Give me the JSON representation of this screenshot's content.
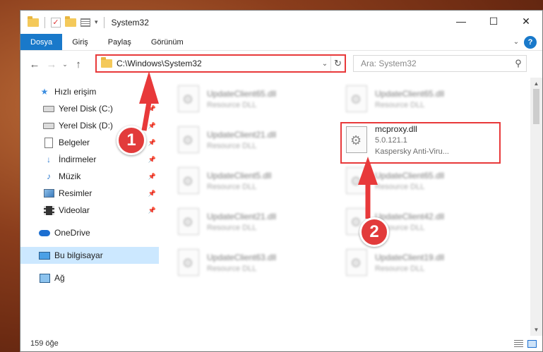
{
  "window": {
    "title": "System32",
    "controls": {
      "minimize": "—",
      "maximize": "☐",
      "close": "✕"
    }
  },
  "ribbon": {
    "tabs": [
      {
        "label": "Dosya",
        "active": true
      },
      {
        "label": "Giriş"
      },
      {
        "label": "Paylaş"
      },
      {
        "label": "Görünüm"
      }
    ],
    "help": "?"
  },
  "navbar": {
    "address": "C:\\Windows\\System32",
    "search_placeholder": "Ara: System32"
  },
  "sidebar": {
    "items": [
      {
        "label": "Hızlı erişim",
        "icon": "star-icon"
      },
      {
        "label": "Yerel Disk (C:)",
        "icon": "drive-icon",
        "pinned": true
      },
      {
        "label": "Yerel Disk (D:)",
        "icon": "drive-icon",
        "pinned": true
      },
      {
        "label": "Belgeler",
        "icon": "documents-icon",
        "pinned": true
      },
      {
        "label": "İndirmeler",
        "icon": "download-icon",
        "pinned": true
      },
      {
        "label": "Müzik",
        "icon": "music-icon",
        "pinned": true
      },
      {
        "label": "Resimler",
        "icon": "pictures-icon",
        "pinned": true
      },
      {
        "label": "Videolar",
        "icon": "videos-icon",
        "pinned": true
      },
      {
        "label": "OneDrive",
        "icon": "onedrive-icon"
      },
      {
        "label": "Bu bilgisayar",
        "icon": "this-pc-icon",
        "selected": true
      },
      {
        "label": "Ağ",
        "icon": "network-icon"
      }
    ]
  },
  "files": [
    {
      "name": "UpdateClient65.dll",
      "type": "Resource DLL"
    },
    {
      "name": "UpdateClient65.dll",
      "type": "Resource DLL"
    },
    {
      "name": "UpdateClient21.dll",
      "type": "Resource DLL"
    },
    {
      "name": "mcproxy.dll",
      "version": "5.0.121.1",
      "company": "Kaspersky Anti-Viru..."
    },
    {
      "name": "UpdateClient5.dll",
      "type": "Resource DLL"
    },
    {
      "name": "UpdateClient65.dll",
      "type": "Resource DLL"
    },
    {
      "name": "UpdateClient21.dll",
      "type": "Resource DLL"
    },
    {
      "name": "UpdateClient42.dll",
      "type": "Resource DLL"
    },
    {
      "name": "UpdateClient63.dll",
      "type": "Resource DLL"
    },
    {
      "name": "UpdateClient19.dll",
      "type": "Resource DLL"
    }
  ],
  "status": {
    "count": "159 öğe"
  },
  "annotations": {
    "step1": "1",
    "step2": "2",
    "color": "#e8393a"
  }
}
